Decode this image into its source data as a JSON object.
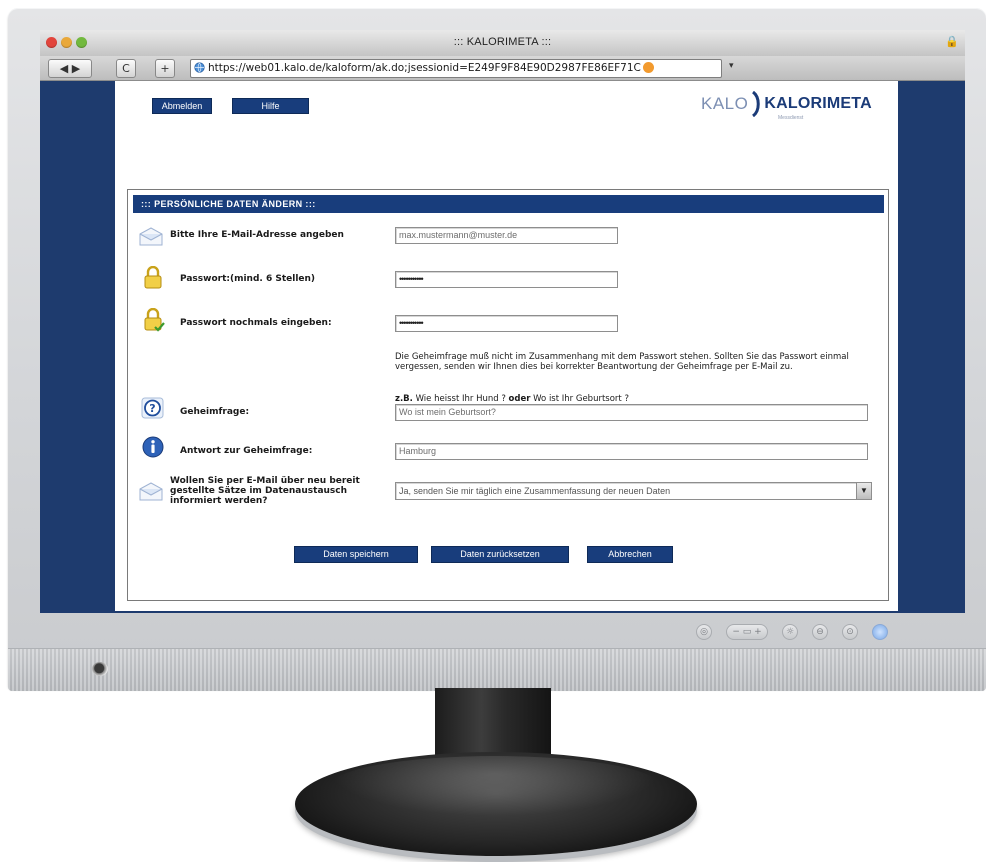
{
  "window": {
    "title": "::: KALORIMETA :::",
    "url": "https://web01.kalo.de/kaloform/ak.do;jsessionid=E249F9F84E90D2987FE86EF71C"
  },
  "nav": {
    "logout": "Abmelden",
    "help": "Hilfe"
  },
  "logo": {
    "kalo": "KALO",
    "name": "KALORIMETA",
    "tagline": "Messdienst"
  },
  "form": {
    "header": "::: PERSÖNLICHE DATEN ÄNDERN :::",
    "email": {
      "label": "Bitte Ihre E-Mail-Adresse angeben",
      "value": "max.mustermann@muster.de"
    },
    "password": {
      "label": "Passwort:(mind. 6 Stellen)",
      "value": "•••••••••••"
    },
    "password_repeat": {
      "label": "Passwort nochmals eingeben:",
      "value": "•••••••••••"
    },
    "hint": "Die Geheimfrage muß nicht im Zusammenhang mit dem Passwort stehen. Sollten Sie das Passwort einmal vergessen, senden wir Ihnen dies bei korrekter Beantwortung der Geheimfrage per E-Mail zu.",
    "example": {
      "prefix": "z.B.",
      "q1": "Wie heisst Ihr Hund ?",
      "or": "oder",
      "q2": "Wo ist Ihr Geburtsort ?"
    },
    "secret_question": {
      "label": "Geheimfrage:",
      "value": "Wo ist mein Geburtsort?"
    },
    "secret_answer": {
      "label": "Antwort zur Geheimfrage:",
      "value": "Hamburg"
    },
    "notify": {
      "label": "Wollen Sie per E-Mail über neu bereit gestellte Sätze im Datenaustausch informiert werden?",
      "selected": "Ja, senden Sie mir täglich eine Zusammenfassung der neuen Daten"
    },
    "buttons": {
      "save": "Daten speichern",
      "reset": "Daten zurücksetzen",
      "cancel": "Abbrechen"
    }
  },
  "colors": {
    "navy": "#183d7c",
    "browser_frame": "#1e3b6e"
  }
}
